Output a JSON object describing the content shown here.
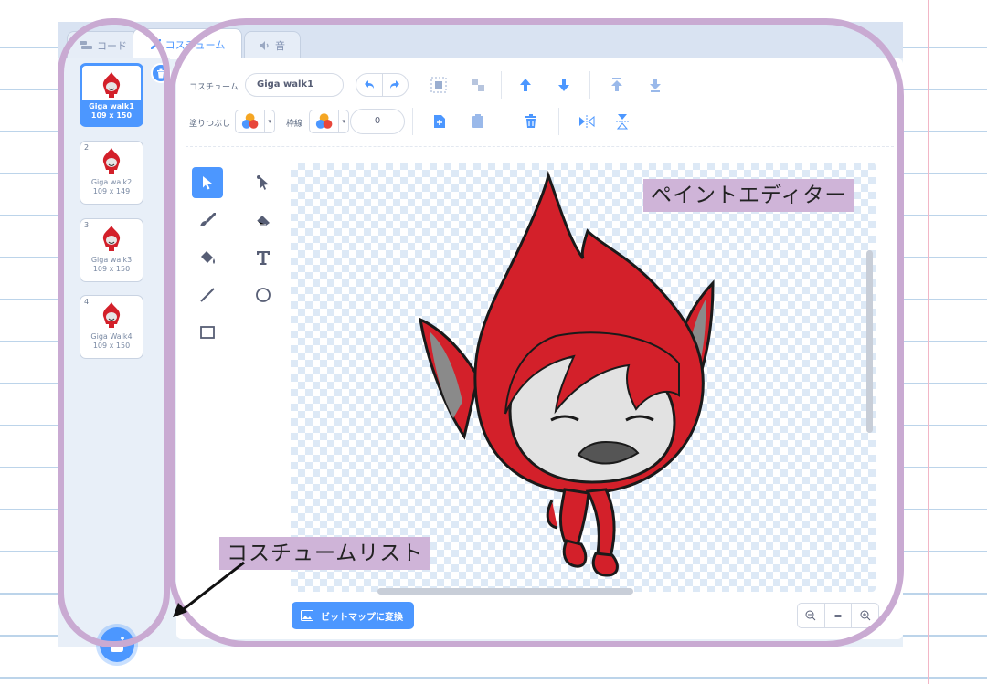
{
  "tabs": [
    {
      "label": "コード",
      "icon": "code-icon"
    },
    {
      "label": "コスチューム",
      "icon": "brush-icon"
    },
    {
      "label": "音",
      "icon": "sound-icon"
    }
  ],
  "costumes": [
    {
      "number": "1",
      "name": "Giga walk1",
      "size": "109 x 150",
      "selected": true
    },
    {
      "number": "2",
      "name": "Giga walk2",
      "size": "109 x 149",
      "selected": false
    },
    {
      "number": "3",
      "name": "Giga walk3",
      "size": "109 x 150",
      "selected": false
    },
    {
      "number": "4",
      "name": "Giga Walk4",
      "size": "109 x 150",
      "selected": false
    }
  ],
  "toolbar": {
    "costume_label": "コスチューム",
    "costume_name": "Giga walk1",
    "fill_label": "塗りつぶし",
    "outline_label": "枠線",
    "outline_width": "0"
  },
  "bitmap_button": "ビットマップに変換",
  "zoom": {
    "zoom_out": "−",
    "reset": "=",
    "zoom_in": "+"
  },
  "annotations": {
    "paint_editor": "ペイントエディター",
    "costume_list": "コスチュームリスト"
  },
  "colors": {
    "accent": "#4c97ff",
    "annotation_frame": "#c9aad2",
    "annotation_label": "#cfb4d8",
    "character_red": "#d3202a"
  }
}
